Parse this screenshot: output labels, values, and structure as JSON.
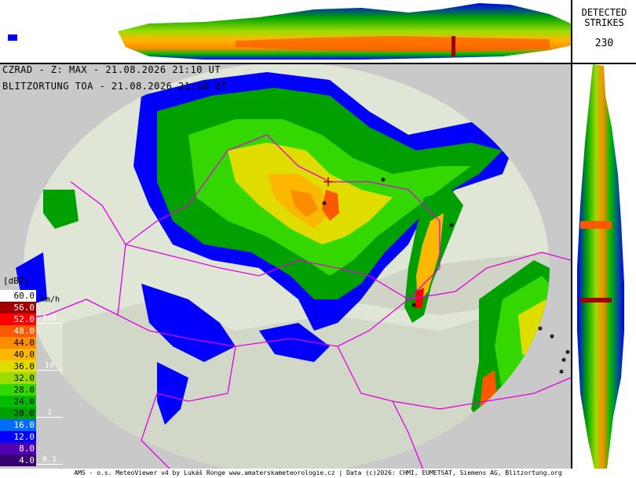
{
  "header": {
    "product_line": "CZRAD - Z: MAX - 21.08.2026 21:10 UT",
    "lightning_line": "BLITZORTUNG TOA - 21.08.2026 21:10 UT"
  },
  "strikes": {
    "label": "DETECTED\nSTRIKES",
    "count": "230"
  },
  "legend": {
    "unit": "[dBZ]",
    "rain_unit": "mm/h",
    "levels": [
      {
        "label": "60.0",
        "color": "#ffffff",
        "text": "#000000"
      },
      {
        "label": "56.0",
        "color": "#a00000",
        "text": "#ffffff"
      },
      {
        "label": "52.0",
        "color": "#fc0000",
        "text": "#ffffff"
      },
      {
        "label": "48.0",
        "color": "#fc5800",
        "text": "#ffffff"
      },
      {
        "label": "44.0",
        "color": "#fc8c00",
        "text": "#000000"
      },
      {
        "label": "40.0",
        "color": "#fcb800",
        "text": "#000000"
      },
      {
        "label": "36.0",
        "color": "#e0dc00",
        "text": "#000000"
      },
      {
        "label": "32.0",
        "color": "#9cdc00",
        "text": "#000000"
      },
      {
        "label": "28.0",
        "color": "#34d800",
        "text": "#000000"
      },
      {
        "label": "24.0",
        "color": "#00bc00",
        "text": "#000000"
      },
      {
        "label": "20.0",
        "color": "#00a000",
        "text": "#000000"
      },
      {
        "label": "16.0",
        "color": "#006cfc",
        "text": "#ffffff"
      },
      {
        "label": "12.0",
        "color": "#0000fc",
        "text": "#ffffff"
      },
      {
        "label": "8.0",
        "color": "#5000b0",
        "text": "#ffffff"
      },
      {
        "label": "4.0",
        "color": "#380070",
        "text": "#ffffff"
      }
    ],
    "rain_marks": [
      {
        "label": "100",
        "level": 2
      },
      {
        "label": "10",
        "level": 6
      },
      {
        "label": "1",
        "level": 10
      },
      {
        "label": "0.1",
        "level": 14
      }
    ]
  },
  "footer": {
    "credit": "AMS - o.s. MeteoViewer v4 by Lukáš Ronge www.amaterskameteorologie.cz | Data (c)2026: CHMI, EUMETSAT, Siemens AG, Blitzortung.org"
  },
  "colors": {
    "background": "#c9c9c9",
    "terrain": "#dfe6d6",
    "borders": "#e000e0",
    "strike": "#000000"
  }
}
